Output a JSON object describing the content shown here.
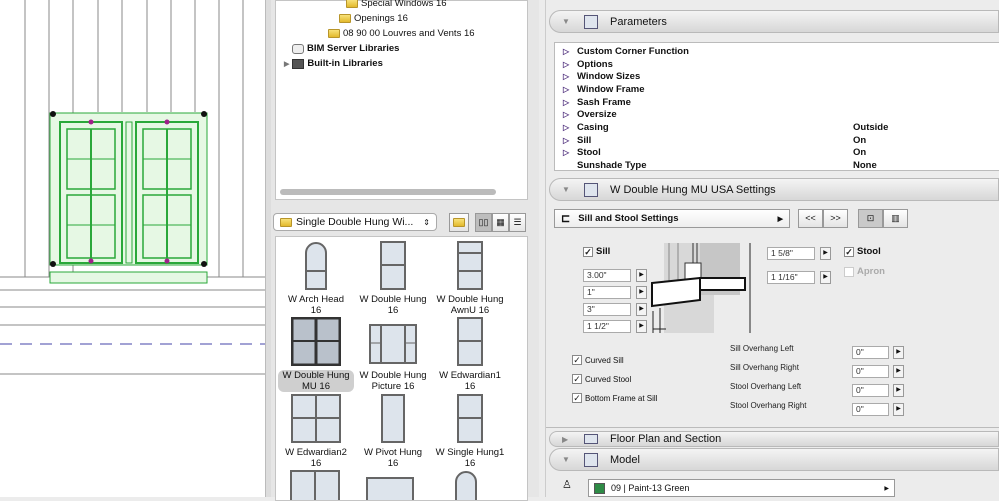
{
  "library": {
    "tree": [
      {
        "label": "Special Windows 16",
        "type": "folder"
      },
      {
        "label": "Openings 16",
        "type": "folder"
      },
      {
        "label": "08 90 00 Louvres and Vents 16",
        "type": "folder"
      },
      {
        "label": "BIM Server Libraries",
        "type": "server"
      },
      {
        "label": "Built-in Libraries",
        "type": "library"
      }
    ],
    "folder_select": "Single Double Hung Wi...",
    "items": [
      {
        "label1": "W Arch Head",
        "label2": "16"
      },
      {
        "label1": "W Double Hung",
        "label2": "16"
      },
      {
        "label1": "W Double Hung",
        "label2": "AwnU 16"
      },
      {
        "label1": "W Double Hung",
        "label2": "MU 16",
        "selected": true
      },
      {
        "label1": "W Double Hung",
        "label2": "Picture 16"
      },
      {
        "label1": "W Edwardian1",
        "label2": "16"
      },
      {
        "label1": "W Edwardian2",
        "label2": "16"
      },
      {
        "label1": "W Pivot Hung",
        "label2": "16"
      },
      {
        "label1": "W Single Hung1",
        "label2": "16"
      }
    ]
  },
  "parameters": {
    "title": "Parameters",
    "rows": [
      {
        "name": "Custom Corner Function",
        "value": ""
      },
      {
        "name": "Options",
        "value": ""
      },
      {
        "name": "Window Sizes",
        "value": ""
      },
      {
        "name": "Window Frame",
        "value": ""
      },
      {
        "name": "Sash Frame",
        "value": ""
      },
      {
        "name": "Oversize",
        "value": ""
      },
      {
        "name": "Casing",
        "value": "Outside"
      },
      {
        "name": "Sill",
        "value": "On"
      },
      {
        "name": "Stool",
        "value": "On"
      },
      {
        "name": "Sunshade Type",
        "value": "None"
      }
    ]
  },
  "settings": {
    "title": "W Double Hung MU USA Settings",
    "page": "Sill and Stool Settings",
    "prev": "<<",
    "next": ">>",
    "sill_label": "Sill",
    "stool_label": "Stool",
    "apron_label": "Apron",
    "sill_values": [
      "3.00\"",
      "1\"",
      "3\"",
      "1 1/2\""
    ],
    "stool_values": [
      "1 5/8\"",
      "1 1/16\""
    ],
    "checks": [
      "Curved Sill",
      "Curved Stool",
      "Bottom Frame at Sill"
    ],
    "overhangs": [
      {
        "label": "Sill Overhang Left",
        "value": "0\""
      },
      {
        "label": "Sill Overhang Right",
        "value": "0\""
      },
      {
        "label": "Stool Overhang Left",
        "value": "0\""
      },
      {
        "label": "Stool Overhang Right",
        "value": "0\""
      }
    ]
  },
  "floor_plan": {
    "title": "Floor Plan and Section"
  },
  "model": {
    "title": "Model",
    "material": "09 | Paint-13 Green",
    "material_color": "#2e8b46"
  }
}
